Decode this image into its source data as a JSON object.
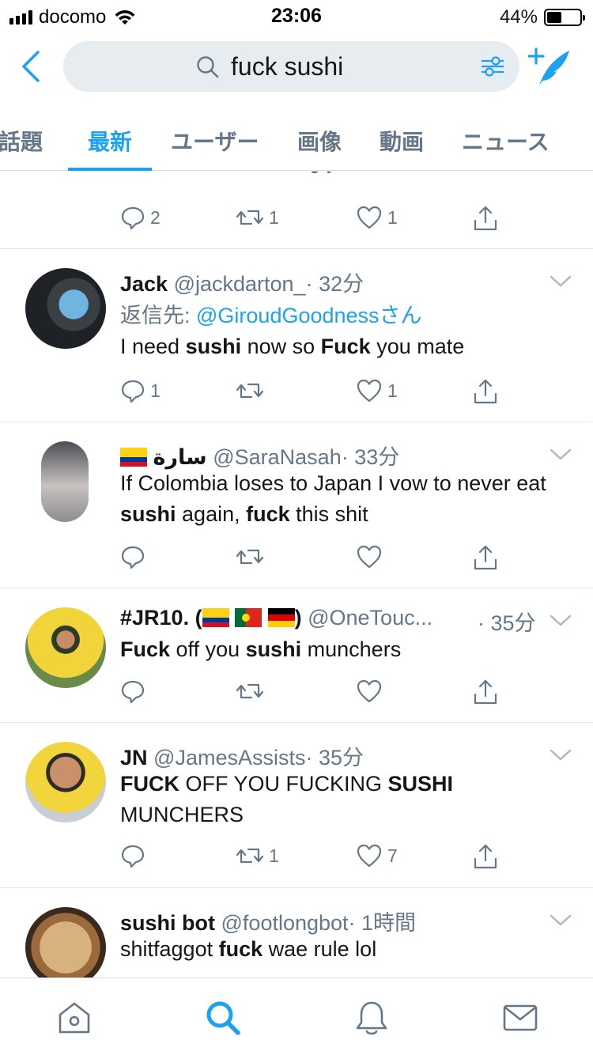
{
  "status_bar": {
    "carrier": "docomo",
    "time": "23:06",
    "battery_percent": "44%",
    "battery_level": 0.44
  },
  "search": {
    "query": "fuck sushi"
  },
  "tabs": [
    {
      "label": "話題",
      "active": false
    },
    {
      "label": "最新",
      "active": true
    },
    {
      "label": "ユーザー",
      "active": false
    },
    {
      "label": "画像",
      "active": false
    },
    {
      "label": "動画",
      "active": false
    },
    {
      "label": "ニュース",
      "active": false
    }
  ],
  "tweets": [
    {
      "text_html": "whole asssss fucking year!!!!! <b>Fuck</b> that",
      "reply_count": "2",
      "retweet_count": "1",
      "like_count": "1"
    },
    {
      "name": "Jack",
      "handle": "@jackdarton_",
      "time": "· 32分",
      "reply_prefix": "返信先: ",
      "reply_mention": "@GiroudGoodnessさん",
      "text_html": "I need <b>sushi</b> now so <b>Fuck</b> you mate",
      "reply_count": "1",
      "retweet_count": "",
      "like_count": "1"
    },
    {
      "name": "سارة",
      "handle": "@SaraNasah",
      "time": "· 33分",
      "text_html": "If Colombia loses to Japan I vow to never eat <b>sushi</b> again, <b>fuck</b> this shit",
      "reply_count": "",
      "retweet_count": "",
      "like_count": ""
    },
    {
      "name_prefix": "#JR10. (",
      "name_suffix": ")",
      "handle": "@OneTouc...",
      "time": "· 35分",
      "text_html": "<b>Fuck</b> off you <b>sushi</b> munchers",
      "reply_count": "",
      "retweet_count": "",
      "like_count": ""
    },
    {
      "name": "JN",
      "handle": "@JamesAssists",
      "time": "· 35分",
      "text_html": "<b>FUCK</b> OFF YOU FUCKING <b>SUSHI</b> MUNCHERS",
      "reply_count": "",
      "retweet_count": "1",
      "like_count": "7"
    },
    {
      "name": "sushi bot",
      "handle": "@footlongbot",
      "time": "· 1時間",
      "text_html": "shitfaggot <b>fuck</b> wae rule lol"
    }
  ],
  "tabbar": {
    "items": [
      "home-icon",
      "search-icon",
      "notifications-icon",
      "messages-icon"
    ],
    "active_index": 1
  },
  "colors": {
    "accent": "#1da1f2",
    "secondary_text": "#657786",
    "primary_text": "#14171a",
    "divider": "#e1e8ed"
  }
}
